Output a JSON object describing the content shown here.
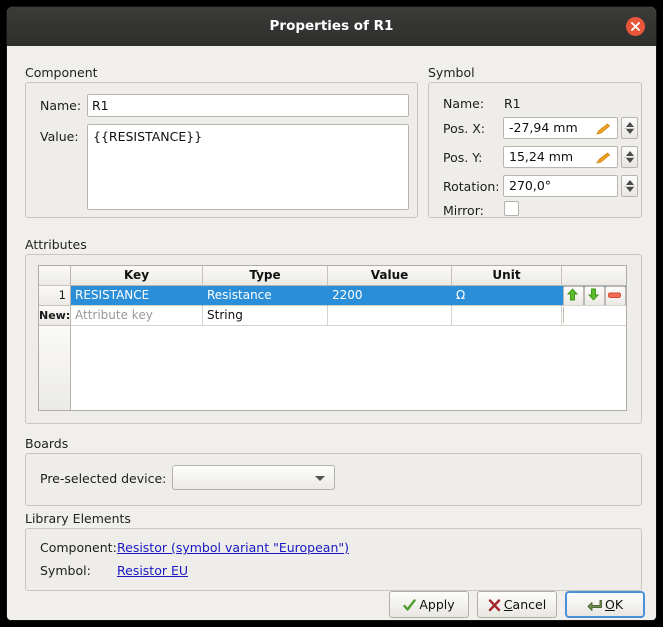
{
  "window": {
    "title": "Properties of R1",
    "close_icon": "close-icon"
  },
  "component": {
    "group_title": "Component",
    "name_label": "Name:",
    "name_value": "R1",
    "value_label": "Value:",
    "value_text": "{{RESISTANCE}}"
  },
  "symbol": {
    "group_title": "Symbol",
    "name_label": "Name:",
    "name_value": "R1",
    "posx_label": "Pos. X:",
    "posx_value": "-27,94 mm",
    "posy_label": "Pos. Y:",
    "posy_value": "15,24 mm",
    "rotation_label": "Rotation:",
    "rotation_value": "270,0°",
    "mirror_label": "Mirror:",
    "mirror_checked": false,
    "pencil_icon": "pencil-icon"
  },
  "attributes": {
    "group_title": "Attributes",
    "columns": [
      "Key",
      "Type",
      "Value",
      "Unit"
    ],
    "rows": [
      {
        "index": "1",
        "key": "RESISTANCE",
        "type": "Resistance",
        "value": "2200",
        "unit": "Ω",
        "selected": true,
        "actions": [
          "move-up-icon",
          "move-down-icon",
          "remove-icon"
        ]
      }
    ],
    "new_row": {
      "index": "New:",
      "key_placeholder": "Attribute key",
      "type": "String",
      "value": "",
      "unit": "",
      "action": "add-icon"
    }
  },
  "boards": {
    "group_title": "Boards",
    "device_label": "Pre-selected device:",
    "device_value": "",
    "device_options": [
      ""
    ]
  },
  "library_elements": {
    "group_title": "Library Elements",
    "component_label": "Component:",
    "component_link": "Resistor (symbol variant \"European\")",
    "symbol_label": "Symbol:",
    "symbol_link": "Resistor EU"
  },
  "buttons": {
    "apply": "Apply",
    "cancel": "Cancel",
    "ok": "OK"
  },
  "colors": {
    "selection_blue": "#2a8fd8",
    "link_blue": "#1a19c4",
    "close_orange": "#e8563a",
    "accent_green": "#4eb523",
    "pencil_orange": "#f0a022",
    "remove_red": "#e8604c",
    "dialog_bg": "#f0efec",
    "titlebar_bg": "#2e2e2c"
  }
}
